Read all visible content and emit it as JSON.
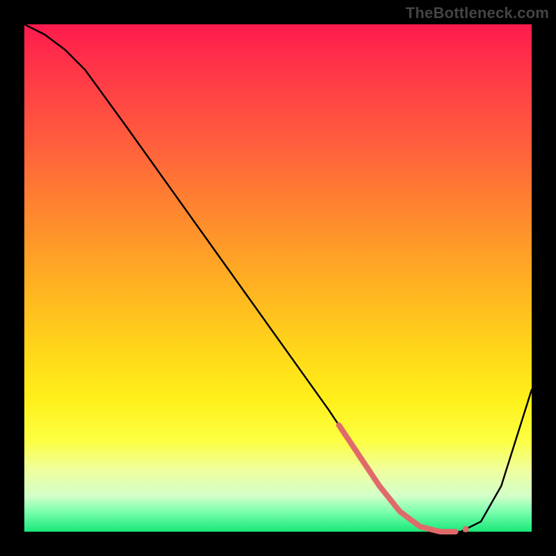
{
  "watermark": "TheBottleneck.com",
  "chart_data": {
    "type": "line",
    "title": "",
    "xlabel": "",
    "ylabel": "",
    "xlim": [
      0,
      100
    ],
    "ylim": [
      0,
      100
    ],
    "series": [
      {
        "name": "curve",
        "x": [
          0,
          4,
          8,
          12,
          20,
          30,
          40,
          50,
          60,
          66,
          70,
          74,
          78,
          82,
          86,
          90,
          94,
          100
        ],
        "y": [
          100,
          98,
          95,
          91,
          80,
          66,
          52,
          38,
          24,
          15,
          9,
          4,
          1,
          0,
          0,
          2,
          9,
          28
        ]
      }
    ],
    "flat_segment": {
      "x_start": 62,
      "x_end": 85,
      "color": "#e06a6a"
    },
    "gradient_stops": [
      {
        "pct": 0,
        "color": "#ff1a4d"
      },
      {
        "pct": 8,
        "color": "#ff3348"
      },
      {
        "pct": 22,
        "color": "#ff5a3e"
      },
      {
        "pct": 38,
        "color": "#ff8a2e"
      },
      {
        "pct": 52,
        "color": "#ffb321"
      },
      {
        "pct": 64,
        "color": "#ffd61a"
      },
      {
        "pct": 74,
        "color": "#fff01a"
      },
      {
        "pct": 82,
        "color": "#fcff42"
      },
      {
        "pct": 88,
        "color": "#efffa0"
      },
      {
        "pct": 93,
        "color": "#d2ffc8"
      },
      {
        "pct": 96,
        "color": "#7dffb0"
      },
      {
        "pct": 100,
        "color": "#18e879"
      }
    ]
  }
}
